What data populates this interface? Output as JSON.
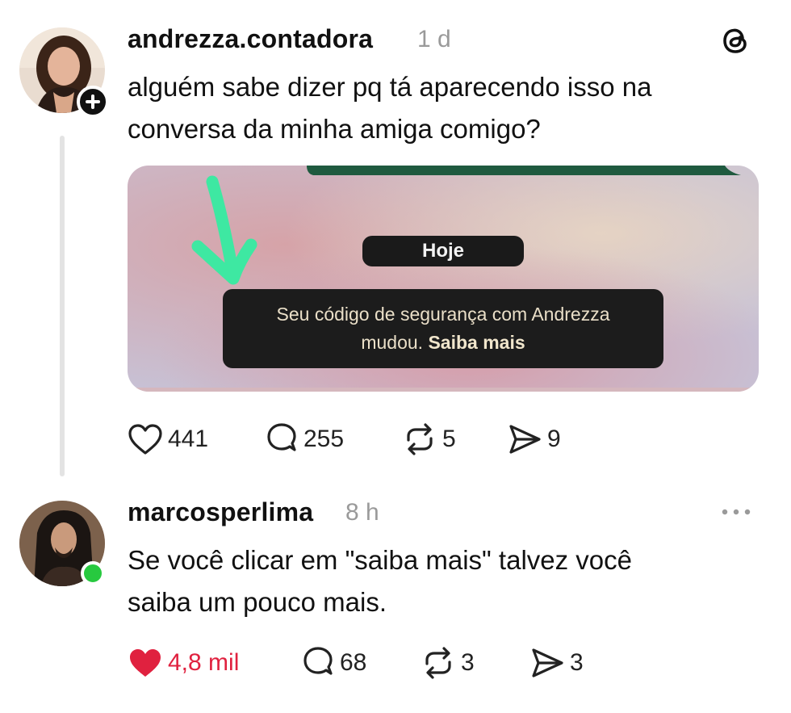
{
  "post": {
    "username": "andrezza.contadora",
    "time": "1 d",
    "text_line1": "alguém sabe dizer pq tá aparecendo isso na",
    "text_line2": "conversa da minha amiga comigo?",
    "image": {
      "date_chip": "Hoje",
      "notice_line1": "Seu código de segurança com Andrezza",
      "notice_line2_prefix": "mudou. ",
      "notice_link": "Saiba mais"
    },
    "stats": {
      "likes": "441",
      "replies": "255",
      "reposts": "5",
      "shares": "9"
    }
  },
  "reply": {
    "username": "marcosperlima",
    "time": "8 h",
    "text_line1": "Se você clicar em \"saiba mais\" talvez você",
    "text_line2": "saiba um pouco mais.",
    "stats": {
      "likes": "4,8 mil",
      "replies": "68",
      "reposts": "3",
      "shares": "3"
    }
  },
  "icons": {
    "app_logo": "threads-logo-icon",
    "follow": "plus-icon",
    "like": "heart-icon",
    "reply": "comment-icon",
    "repost": "repost-icon",
    "share": "send-icon",
    "more": "more-horizontal-icon"
  },
  "colors": {
    "liked": "#e0213f",
    "online": "#27c93f",
    "annotation_arrow": "#3ee8a2"
  }
}
